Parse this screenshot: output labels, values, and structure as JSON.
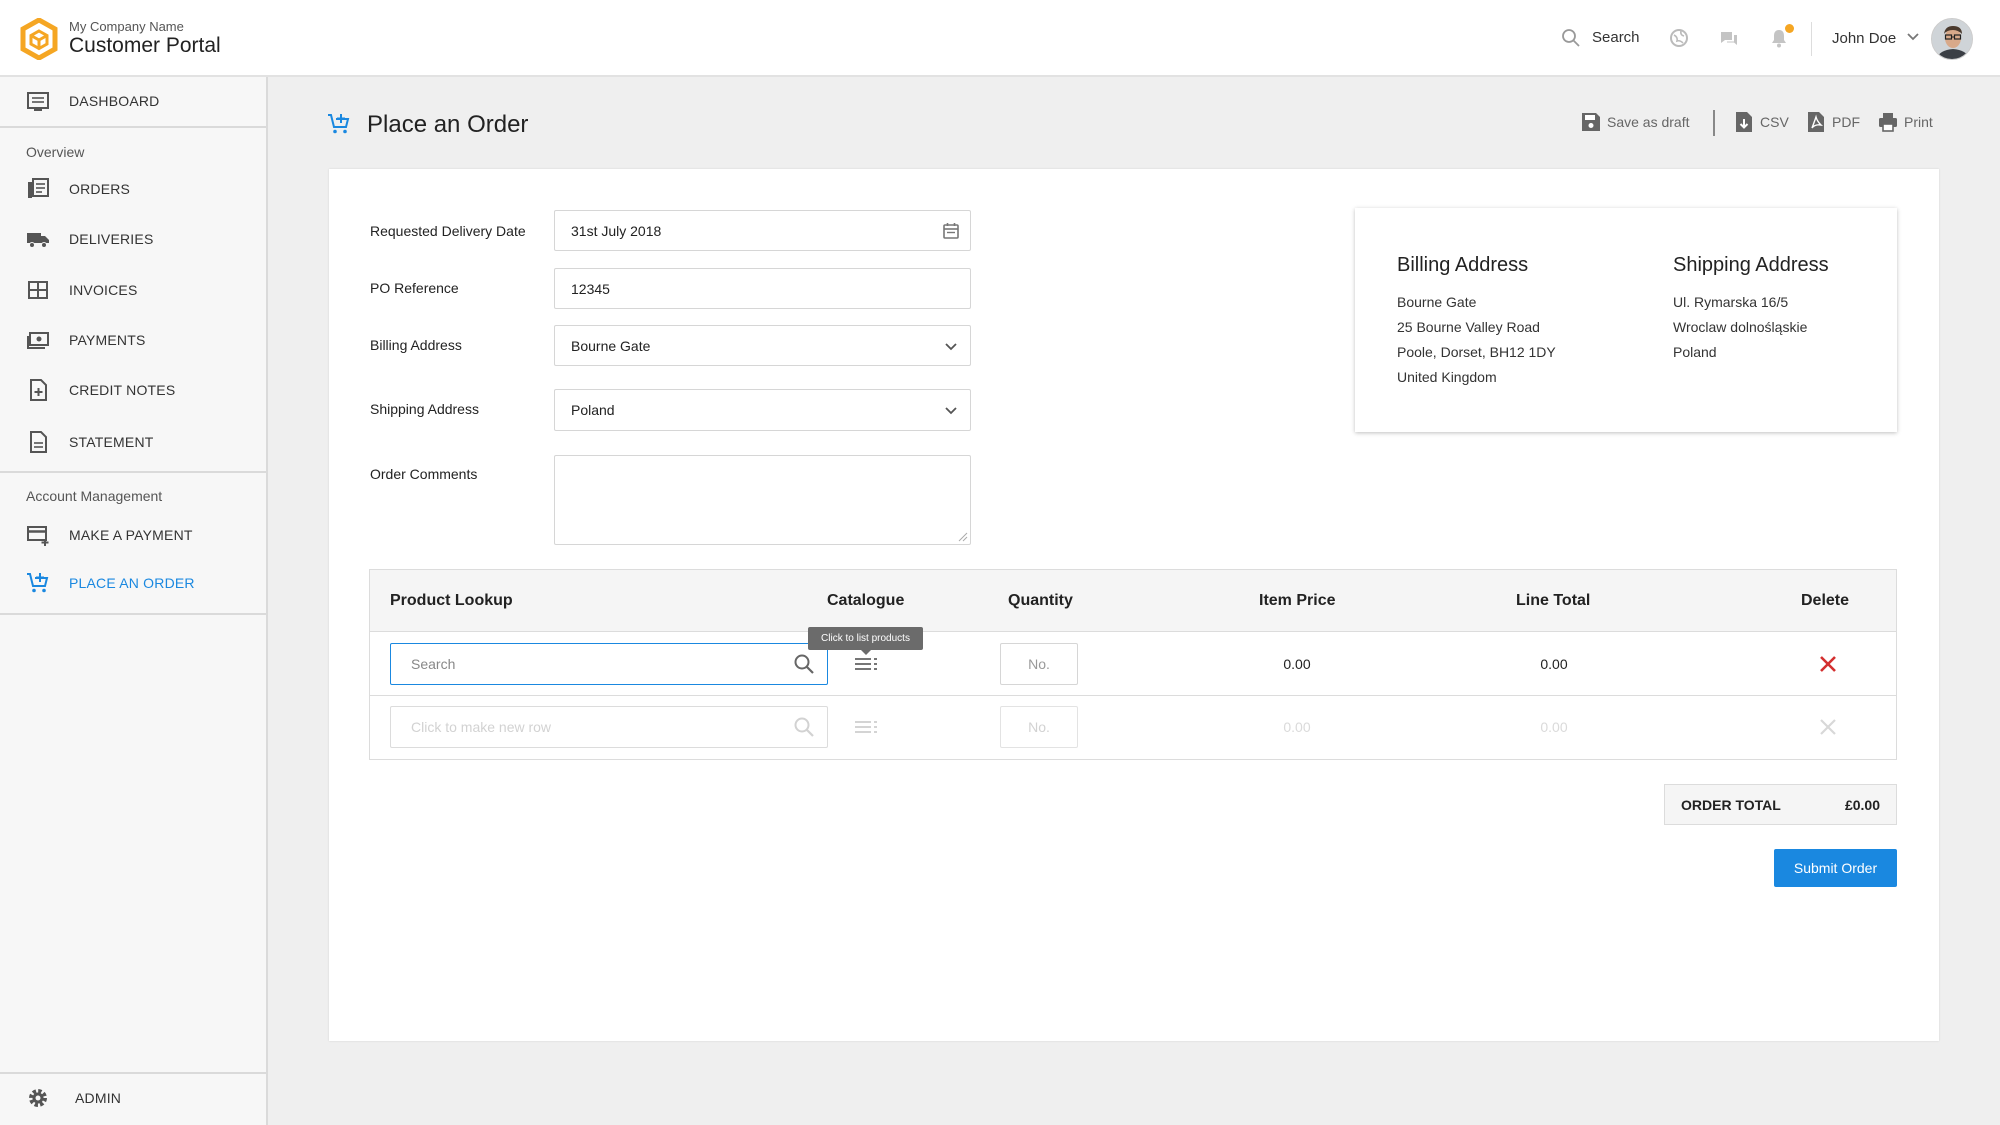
{
  "header": {
    "company_name": "My Company Name",
    "portal_title": "Customer Portal",
    "search_label": "Search",
    "user_name": "John Doe"
  },
  "sidebar": {
    "dashboard": "DASHBOARD",
    "overview_heading": "Overview",
    "orders": "ORDERS",
    "deliveries": "DELIVERIES",
    "invoices": "INVOICES",
    "payments": "PAYMENTS",
    "credit_notes": "CREDIT NOTES",
    "statement": "STATEMENT",
    "account_heading": "Account Management",
    "make_payment": "MAKE A PAYMENT",
    "place_order": "PLACE AN ORDER",
    "admin": "ADMIN"
  },
  "page": {
    "title": "Place an Order",
    "toolbar": {
      "save_draft": "Save as draft",
      "csv": "CSV",
      "pdf": "PDF",
      "print": "Print"
    }
  },
  "form": {
    "delivery_date_label": "Requested Delivery Date",
    "delivery_date_value": "31st July 2018",
    "po_label": "PO Reference",
    "po_value": "12345",
    "billing_label": "Billing Address",
    "billing_value": "Bourne Gate",
    "shipping_label": "Shipping Address",
    "shipping_value": "Poland",
    "comments_label": "Order Comments",
    "comments_value": ""
  },
  "addresses": {
    "billing": {
      "heading": "Billing Address",
      "lines": [
        "Bourne Gate",
        "25 Bourne Valley Road",
        "Poole, Dorset, BH12 1DY",
        "United Kingdom"
      ]
    },
    "shipping": {
      "heading": "Shipping Address",
      "lines": [
        "Ul. Rymarska 16/5",
        "Wroclaw dolnośląskie",
        "Poland"
      ]
    }
  },
  "table": {
    "headers": {
      "lookup": "Product Lookup",
      "catalogue": "Catalogue",
      "quantity": "Quantity",
      "item_price": "Item Price",
      "line_total": "Line Total",
      "delete": "Delete"
    },
    "rows": [
      {
        "lookup_placeholder": "Search",
        "qty_placeholder": "No.",
        "item_price": "0.00",
        "line_total": "0.00"
      },
      {
        "lookup_placeholder": "Click to make new row",
        "qty_placeholder": "No.",
        "item_price": "0.00",
        "line_total": "0.00"
      }
    ],
    "catalogue_tooltip": "Click to list products"
  },
  "order_total": {
    "label": "ORDER TOTAL",
    "value": "£0.00"
  },
  "submit_label": "Submit Order",
  "colors": {
    "accent": "#1a88e0",
    "logo": "#f5a623",
    "delete": "#d32f2f"
  }
}
